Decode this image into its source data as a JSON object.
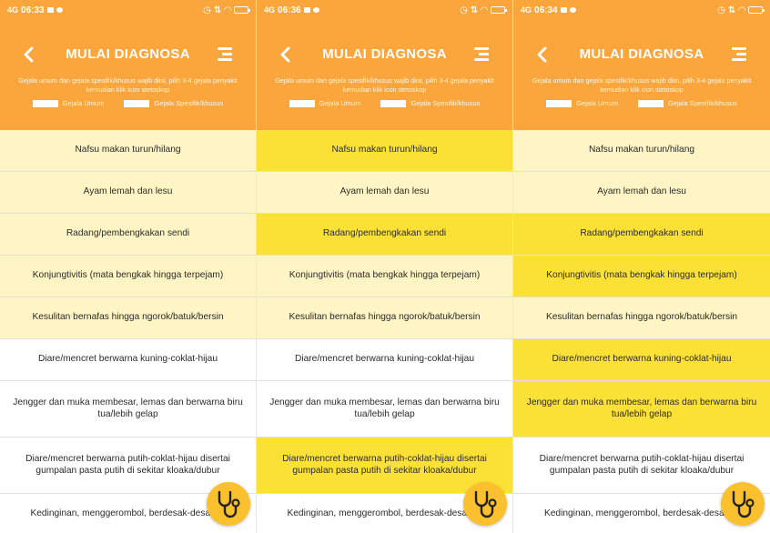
{
  "colors": {
    "header": "#fba63c",
    "general_symptom_bg": "#fff5c4",
    "specific_symptom_bg": "#ffffff",
    "selected_bg": "#fbe135",
    "fab": "#fbc02d"
  },
  "symptoms": [
    "Nafsu makan turun/hilang",
    "Ayam lemah dan lesu",
    "Radang/pembengkakan sendi",
    "Konjungtivitis (mata bengkak hingga terpejam)",
    "Kesulitan bernafas hingga ngorok/batuk/bersin",
    "Diare/mencret berwarna kuning-coklat-hijau",
    "Jengger dan muka membesar, lemas dan berwarna biru tua/lebih gelap",
    "Diare/mencret berwarna putih-coklat-hijau disertai gumpalan pasta putih di sekitar kloaka/dubur",
    "Kedinginan, menggerombol, berdesak-desakan"
  ],
  "screens": [
    {
      "status": {
        "time": "06:33",
        "signal": "4G"
      },
      "title": "MULAI DIAGNOSA",
      "instruction": "Gejala umum dan gejala spesifik/khusus wajib diisi, pilih 3-4 gejala penyakit kemudian klik icon stetoskop",
      "legend": {
        "general": "Gejala Umum",
        "specific": "Gejala Spesifik/khusus"
      },
      "items": [
        {
          "label": "Nafsu makan turun/hilang",
          "state": "light"
        },
        {
          "label": "Ayam lemah dan lesu",
          "state": "light"
        },
        {
          "label": "Radang/pembengkakan sendi",
          "state": "light"
        },
        {
          "label": "Konjungtivitis (mata bengkak hingga terpejam)",
          "state": "light"
        },
        {
          "label": "Kesulitan bernafas hingga ngorok/batuk/bersin",
          "state": "light"
        },
        {
          "label": "Diare/mencret berwarna kuning-coklat-hijau",
          "state": "white"
        },
        {
          "label": "Jengger dan muka membesar, lemas dan berwarna biru tua/lebih gelap",
          "state": "white"
        },
        {
          "label": "Diare/mencret berwarna putih-coklat-hijau disertai gumpalan pasta putih di sekitar kloaka/dubur",
          "state": "white"
        },
        {
          "label": "Kedinginan, menggerombol, berdesak-desakan",
          "state": "white"
        }
      ]
    },
    {
      "status": {
        "time": "06:36",
        "signal": "4G"
      },
      "title": "MULAI DIAGNOSA",
      "instruction": "Gejala umum dan gejala spesifik/khusus wajib diisi, pilih 3-4 gejala penyakit kemudian klik icon stetoskop",
      "legend": {
        "general": "Gejala Umum",
        "specific": "Gejala Spesifik/khusus"
      },
      "items": [
        {
          "label": "Nafsu makan turun/hilang",
          "state": "selected"
        },
        {
          "label": "Ayam lemah dan lesu",
          "state": "light"
        },
        {
          "label": "Radang/pembengkakan sendi",
          "state": "selected"
        },
        {
          "label": "Konjungtivitis (mata bengkak hingga terpejam)",
          "state": "light"
        },
        {
          "label": "Kesulitan bernafas hingga ngorok/batuk/bersin",
          "state": "light"
        },
        {
          "label": "Diare/mencret berwarna kuning-coklat-hijau",
          "state": "white"
        },
        {
          "label": "Jengger dan muka membesar, lemas dan berwarna biru tua/lebih gelap",
          "state": "white"
        },
        {
          "label": "Diare/mencret berwarna putih-coklat-hijau disertai gumpalan pasta putih di sekitar kloaka/dubur",
          "state": "selected"
        },
        {
          "label": "Kedinginan, menggerombol, berdesak-desakan",
          "state": "white"
        }
      ]
    },
    {
      "status": {
        "time": "06:34",
        "signal": "4G"
      },
      "title": "MULAI DIAGNOSA",
      "instruction": "Gejala umum dan gejala spesifik/khusus wajib diisi, pilih 3-4 gejala penyakit kemudian klik icon stetoskop",
      "legend": {
        "general": "Gejala Umum",
        "specific": "Gejala Spesifik/khusus"
      },
      "items": [
        {
          "label": "Nafsu makan turun/hilang",
          "state": "light"
        },
        {
          "label": "Ayam lemah dan lesu",
          "state": "light"
        },
        {
          "label": "Radang/pembengkakan sendi",
          "state": "selected"
        },
        {
          "label": "Konjungtivitis (mata bengkak hingga terpejam)",
          "state": "selected"
        },
        {
          "label": "Kesulitan bernafas hingga ngorok/batuk/bersin",
          "state": "light"
        },
        {
          "label": "Diare/mencret berwarna kuning-coklat-hijau",
          "state": "selected"
        },
        {
          "label": "Jengger dan muka membesar, lemas dan berwarna biru tua/lebih gelap",
          "state": "selected"
        },
        {
          "label": "Diare/mencret berwarna putih-coklat-hijau disertai gumpalan pasta putih di sekitar kloaka/dubur",
          "state": "white"
        },
        {
          "label": "Kedinginan, menggerombol, berdesak-desakan",
          "state": "white"
        }
      ]
    }
  ],
  "icons": {
    "back": "chevron-left-icon",
    "menu": "menu-icon",
    "diagnose": "stethoscope-icon"
  }
}
